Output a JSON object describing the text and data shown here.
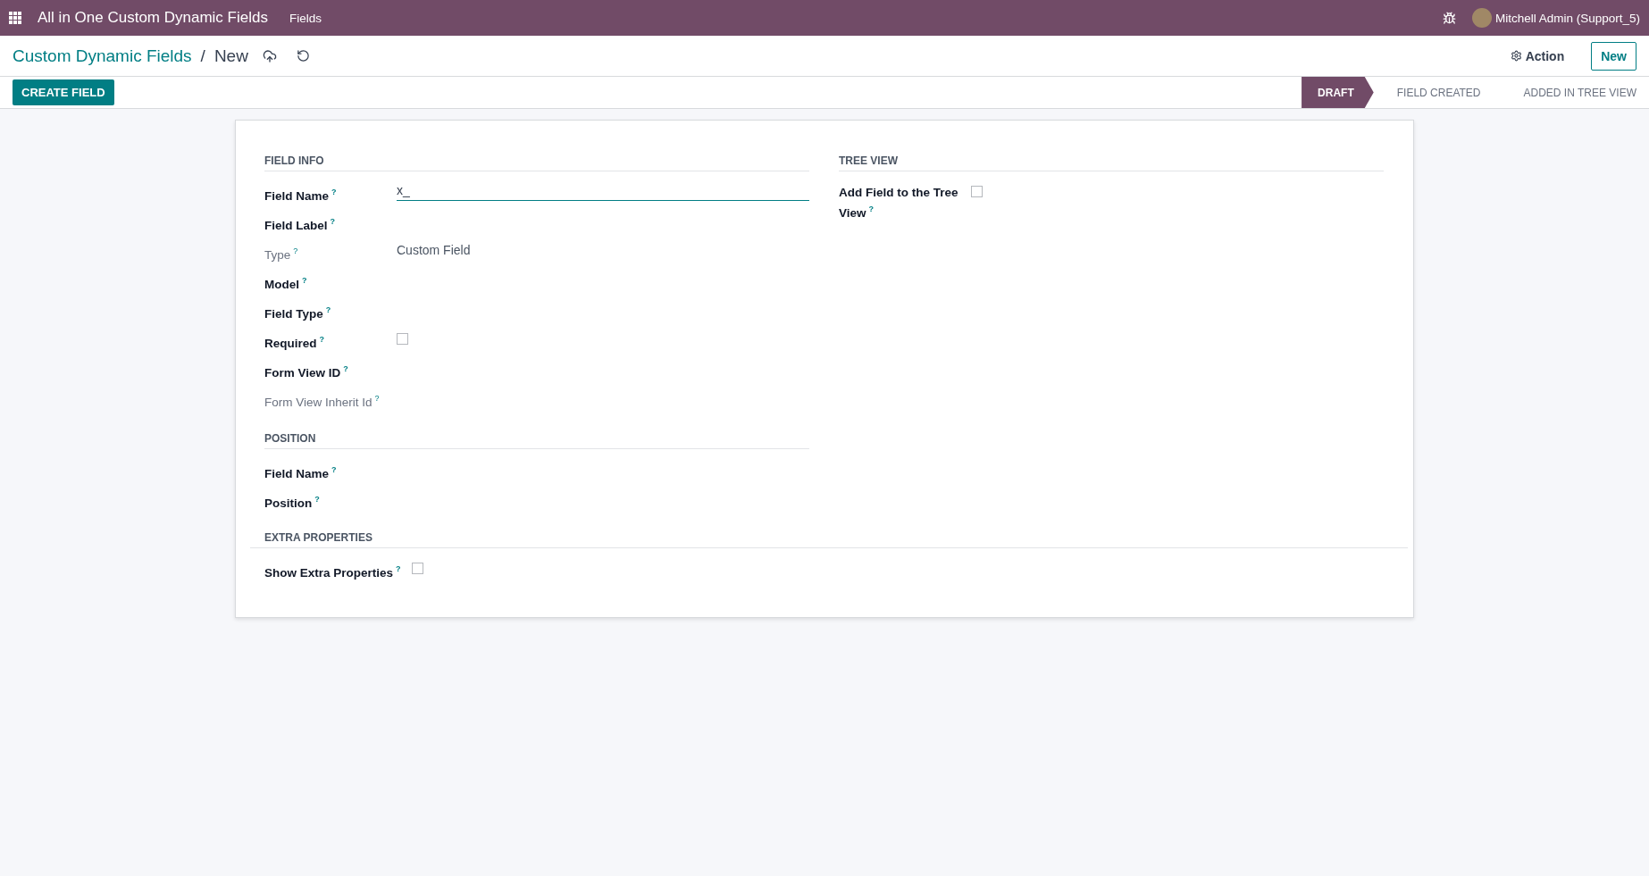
{
  "navbar": {
    "app_title": "All in One Custom Dynamic Fields",
    "menu": [
      "Fields"
    ],
    "user": "Mitchell Admin (Support_5)"
  },
  "breadcrumb": {
    "parent": "Custom Dynamic Fields",
    "separator": "/",
    "current": "New"
  },
  "actions": {
    "action": "Action",
    "new": "New"
  },
  "buttons": [
    "CREATE FIELD"
  ],
  "stages": [
    {
      "label": "DRAFT",
      "selected": true
    },
    {
      "label": "FIELD CREATED",
      "selected": false
    },
    {
      "label": "ADDED IN TREE VIEW",
      "selected": false
    }
  ],
  "left_groups": [
    {
      "title": "FIELD INFO",
      "fields": [
        {
          "label": "Field Name",
          "help": "?",
          "readonly": false,
          "kind": "input",
          "value": "x_"
        },
        {
          "label": "Field Label",
          "help": "?",
          "readonly": false,
          "kind": "empty"
        },
        {
          "label": "Type",
          "help": "?",
          "readonly": true,
          "kind": "text",
          "value": "Custom Field"
        },
        {
          "label": "Model",
          "help": "?",
          "readonly": false,
          "kind": "empty"
        },
        {
          "label": "Field Type",
          "help": "?",
          "readonly": false,
          "kind": "empty"
        },
        {
          "label": "Required",
          "help": "?",
          "readonly": false,
          "kind": "checkbox",
          "checked": false
        },
        {
          "label": "Form View ID",
          "help": "?",
          "readonly": false,
          "kind": "empty"
        },
        {
          "label": "Form View Inherit Id",
          "help": "?",
          "readonly": true,
          "kind": "empty"
        }
      ]
    },
    {
      "title": "POSITION",
      "fields": [
        {
          "label": "Field Name",
          "help": "?",
          "readonly": false,
          "kind": "empty"
        },
        {
          "label": "Position",
          "help": "?",
          "readonly": false,
          "kind": "empty"
        }
      ]
    }
  ],
  "right_groups": [
    {
      "title": "TREE VIEW",
      "fields": [
        {
          "label": "Add Field to the Tree View",
          "help": "?",
          "readonly": false,
          "kind": "checkbox",
          "checked": false
        }
      ]
    }
  ],
  "wide_groups": [
    {
      "title": "EXTRA PROPERTIES",
      "fields": [
        {
          "label": "Show Extra Properties",
          "help": "?",
          "readonly": false,
          "kind": "checkbox",
          "checked": false
        }
      ]
    }
  ]
}
